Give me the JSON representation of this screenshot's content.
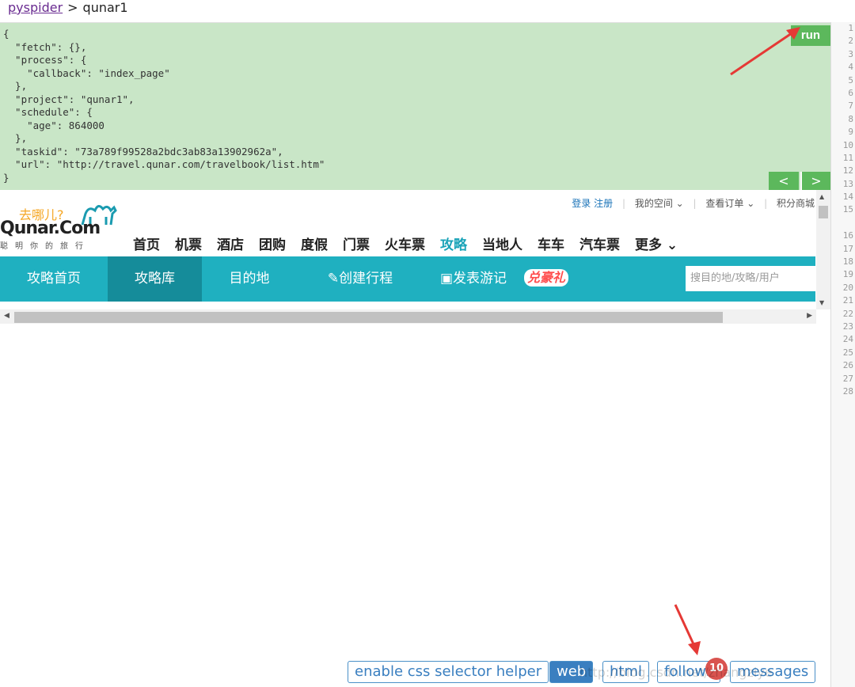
{
  "breadcrumb": {
    "root": "pyspider",
    "separator": ">",
    "project": "qunar1"
  },
  "task_json_lines": [
    "{",
    "  \"fetch\": {},",
    "  \"process\": {",
    "    \"callback\": \"index_page\"",
    "  },",
    "  \"project\": \"qunar1\",",
    "  \"schedule\": {",
    "    \"age\": 864000",
    "  },",
    "  \"taskid\": \"73a789f99528a2bdc3ab83a13902962a\",",
    "  \"url\": \"http://travel.qunar.com/travelbook/list.htm\"",
    "}"
  ],
  "buttons": {
    "run": "run",
    "prev": "<",
    "next": ">"
  },
  "line_numbers": [
    "1",
    "2",
    "3",
    "4",
    "5",
    "6",
    "7",
    "8",
    "9",
    "10",
    "11",
    "12",
    "13",
    "14",
    "15",
    "",
    "16",
    "17",
    "18",
    "19",
    "20",
    "21",
    "22",
    "23",
    "24",
    "25",
    "26",
    "27",
    "28"
  ],
  "qunar": {
    "logo_cn": "去哪儿?",
    "logo_en": "Qunar.Com",
    "logo_sub": "聪明你的旅行",
    "topbar": {
      "login": "登录",
      "register": "注册",
      "my_space": "我的空间 ⌄",
      "orders": "查看订单 ⌄",
      "points": "积分商城"
    },
    "nav": [
      "首页",
      "机票",
      "酒店",
      "团购",
      "度假",
      "门票",
      "火车票",
      "攻略",
      "当地人",
      "车车",
      "汽车票",
      "更多 ⌄"
    ],
    "nav_active": "攻略",
    "subnav": [
      "攻略首页",
      "攻略库",
      "目的地",
      "创建行程",
      "发表游记"
    ],
    "subnav_active": "攻略库",
    "gift": "兑豪礼",
    "search_placeholder": "搜目的地/攻略/用户"
  },
  "tabs": {
    "css_helper": "enable css selector helper",
    "web": "web",
    "html": "html",
    "follows": "follows",
    "follows_count": "10",
    "messages": "messages"
  },
  "watermark": "http://blog.csdn.net/zhangziye",
  "colors": {
    "panel_bg": "#c9e6c7",
    "run_green": "#5cb85c",
    "tab_blue": "#3a7fc0",
    "teal": "#1fb0c0",
    "badge_red": "#d9534f",
    "arrow_red": "#e53935"
  }
}
